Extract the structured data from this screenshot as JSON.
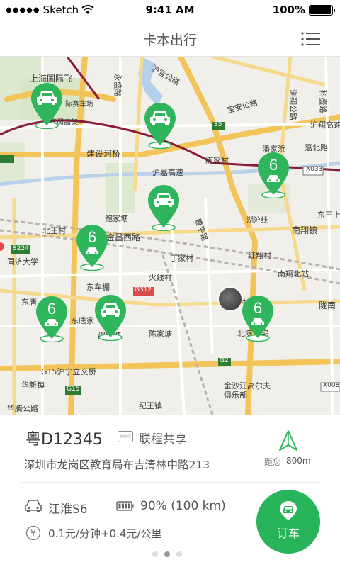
{
  "status_bar": {
    "carrier": "Sketch",
    "time": "9:41 AM",
    "battery": "100%"
  },
  "header": {
    "title": "卡本出行"
  },
  "map": {
    "labels": [
      "上海国际飞",
      "际赛车场",
      "嘉闵高架",
      "永盛路",
      "沪宜公路",
      "宝安公路",
      "浏翔公路",
      "科盛路",
      "沪翔高速",
      "建设河桥",
      "陈家村",
      "沪嘉高速",
      "潘家浜",
      "蕰北路",
      "鲍家塘",
      "北王村",
      "金昌西路",
      "曹平路",
      "湖沪线",
      "南翔镇",
      "东王上",
      "同济大学",
      "丁家村",
      "红翔村",
      "南翔北站",
      "火线村",
      "东车棚",
      "东唐",
      "东唐家",
      "陈家塘",
      "邵家塘",
      "红光村",
      "北陈家宅",
      "陇南",
      "G15沪宁立交桥",
      "华新镇",
      "金沙江高尔夫俱乐部",
      "纪王镇",
      "华腾公路",
      "S224",
      "S5",
      "G312",
      "G2",
      "G15",
      "X033",
      "X008"
    ],
    "pins": [
      {
        "type": "car",
        "name": "car-pin-1"
      },
      {
        "type": "car",
        "name": "car-pin-2"
      },
      {
        "type": "count",
        "count": "6",
        "name": "station-pin-1"
      },
      {
        "type": "car",
        "name": "car-pin-3"
      },
      {
        "type": "count",
        "count": "6",
        "name": "station-pin-2"
      },
      {
        "type": "count",
        "count": "6",
        "name": "station-pin-3"
      },
      {
        "type": "car",
        "name": "car-pin-4"
      },
      {
        "type": "count",
        "count": "6",
        "name": "station-pin-4"
      }
    ]
  },
  "car_card": {
    "plate": "粤D12345",
    "share_badge": "联程共享",
    "share_label": "联程共享",
    "address": "深圳市龙岗区教育局布吉清林中路213",
    "distance_label": "距您",
    "distance_value": "800m",
    "model": "江淮S6",
    "battery": "90% (100 km)",
    "price": "0.1元/分钟+0.4元/公里",
    "order_button": "订车"
  },
  "pager": {
    "count": 3,
    "active": 2
  },
  "colors": {
    "brand_green": "#28b45a",
    "pin_green": "#2fb65c"
  },
  "icons": {
    "wifi": "wifi-icon",
    "menu": "menu-icon",
    "navigate": "navigation-arrow-icon",
    "car": "car-icon",
    "battery": "battery-icon",
    "yuan": "yuan-icon"
  }
}
